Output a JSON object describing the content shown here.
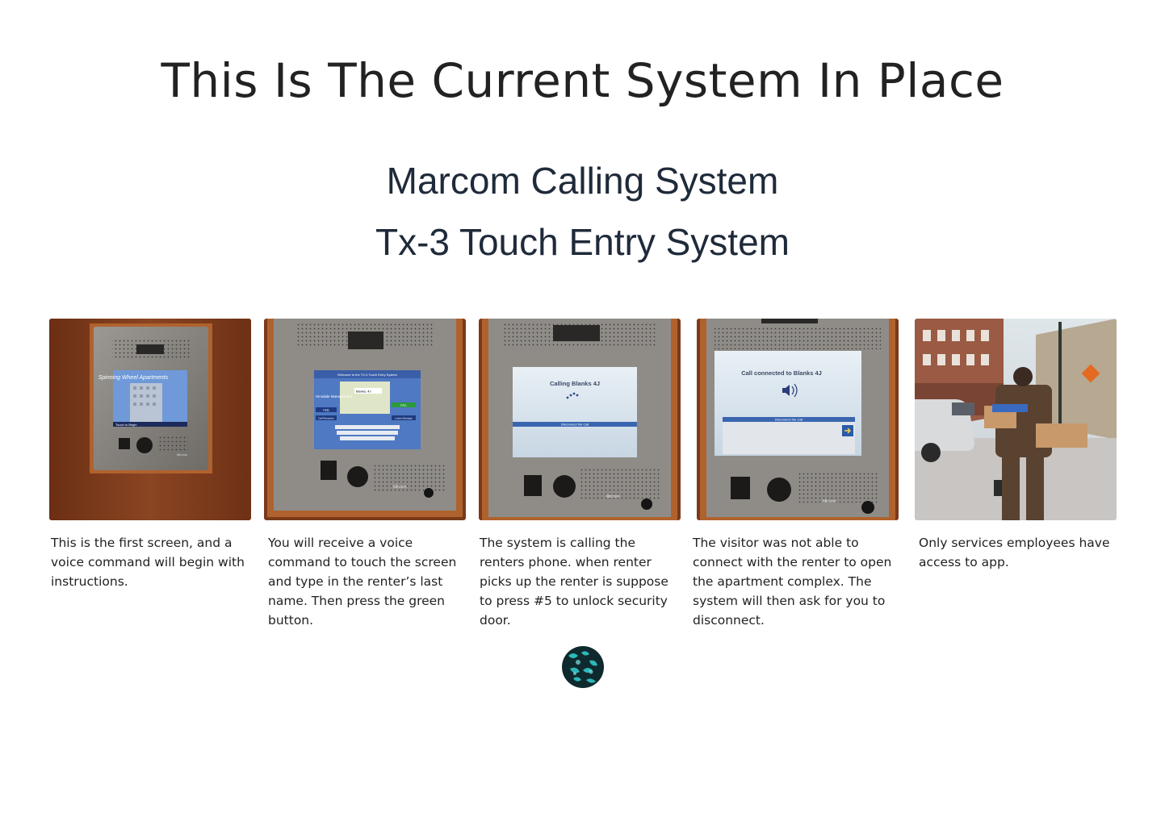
{
  "page": {
    "title": "This Is The Current System In Place",
    "subtitle_1": "Marcom Calling System",
    "subtitle_2": "Tx-3 Touch Entry System"
  },
  "cards": [
    {
      "caption": "This is the first screen, and a voice command will begin with instructions.",
      "screen_title": "Spinning Wheel Apartments",
      "screen_footer": "Touch to Begin",
      "brand": "Mircom"
    },
    {
      "caption": "You will receive  a voice command to touch the screen and type in the renter’s last name. Then press the green button.",
      "screen_header": "Welcome to the TX-3 Touch Entry System",
      "screen_logo": "Hinsdale Management",
      "screen_field": "Blanks, 4J",
      "btn_call": "CALL",
      "btn_help": "Help",
      "btn_reception": "Call Reception",
      "btn_message": "Leave Message",
      "brand": "Mircom"
    },
    {
      "caption": "The system is calling the renters phone. when renter picks up the renter is suppose to press #5 to unlock security door.",
      "screen_text": "Calling  Blanks 4J",
      "screen_bar": "Disconnect the Call",
      "brand": "Mircom"
    },
    {
      "caption": "The visitor was not able to connect with the renter to open the apartment complex. The system will then ask for you to disconnect.",
      "screen_text": "Call connected to   Blanks 4J",
      "screen_bar": "Disconnect the Call",
      "brand": "Mircom"
    },
    {
      "caption": "Only services employees have access to app."
    }
  ],
  "colors": {
    "wood": "#7a3b1c",
    "panel": "#8c8a86",
    "screen": "#d6e4f0",
    "title": "#222222",
    "subtitle": "#1f2a3a"
  }
}
